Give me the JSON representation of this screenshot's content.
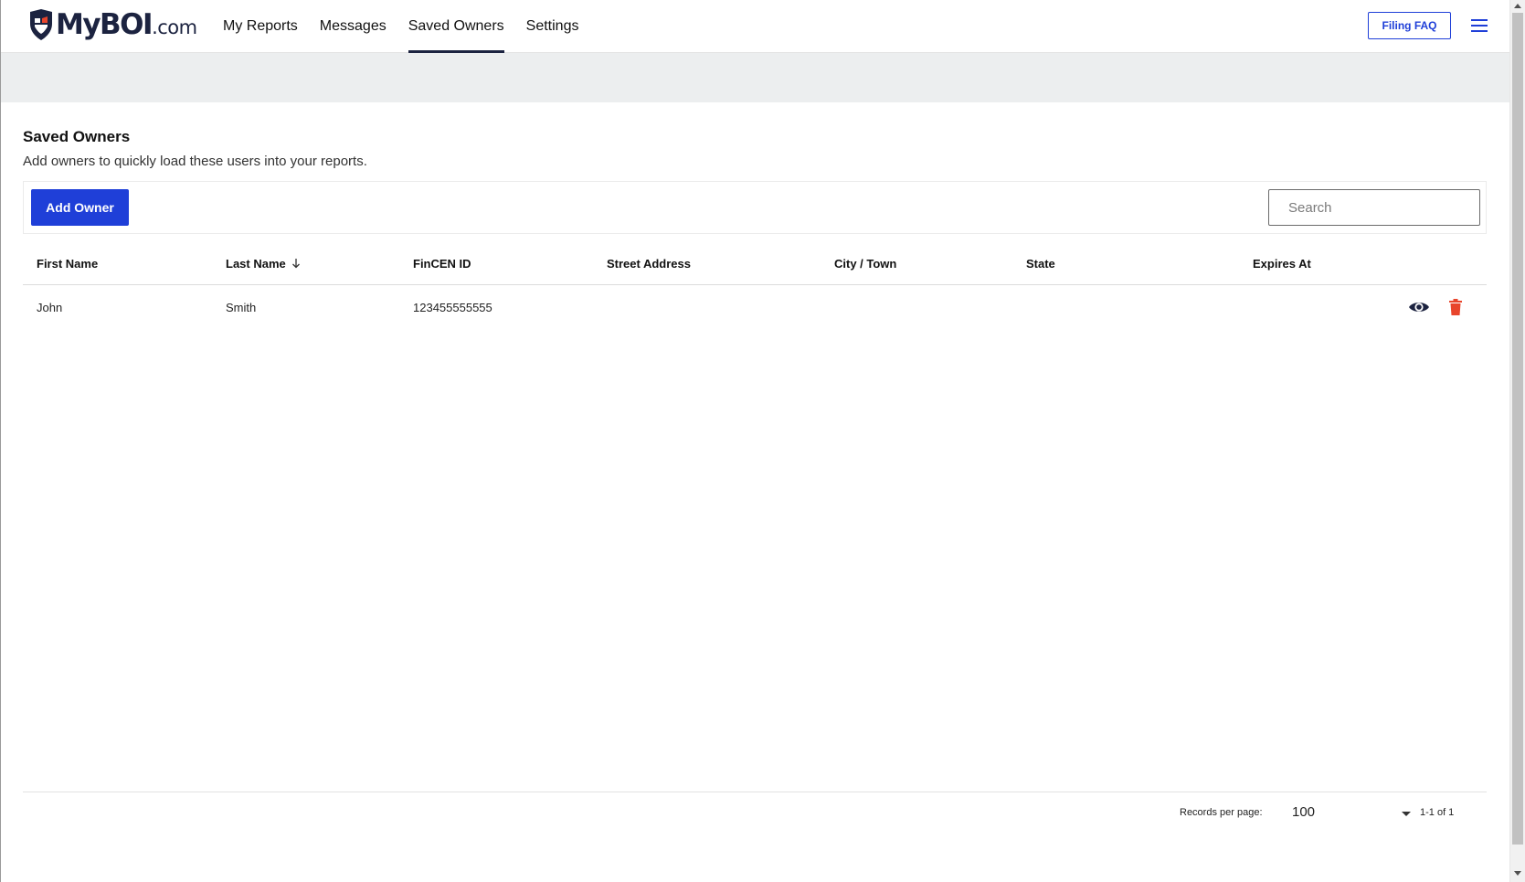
{
  "header": {
    "logo": {
      "brand": "MyBOI",
      "suffix": ".com"
    },
    "nav": [
      {
        "label": "My Reports",
        "active": false
      },
      {
        "label": "Messages",
        "active": false
      },
      {
        "label": "Saved Owners",
        "active": true
      },
      {
        "label": "Settings",
        "active": false
      }
    ],
    "faq_label": "Filing FAQ",
    "menu_icon": "hamburger-menu-icon"
  },
  "page": {
    "title": "Saved Owners",
    "subtitle": "Add owners to quickly load these users into your reports."
  },
  "toolbar": {
    "add_label": "Add Owner",
    "search_placeholder": "Search",
    "search_value": ""
  },
  "table": {
    "columns": [
      "First Name",
      "Last Name",
      "FinCEN ID",
      "Street Address",
      "City / Town",
      "State",
      "Expires At"
    ],
    "sorted_column": "Last Name",
    "sort_direction": "descending",
    "rows": [
      {
        "first_name": "John",
        "last_name": "Smith",
        "fincen_id": "123455555555",
        "street_address": "",
        "city": "",
        "state": "",
        "expires_at": "",
        "actions": [
          "eye-icon",
          "trash-icon"
        ]
      }
    ]
  },
  "pagination": {
    "records_per_page_label": "Records per page:",
    "records_per_page": "100",
    "range": "1-1 of 1"
  },
  "colors": {
    "accent": "#1f3fd8",
    "brand_navy": "#1c2340",
    "brand_red": "#e8452c",
    "delete": "#e8452c",
    "banner": "#eceeef"
  }
}
